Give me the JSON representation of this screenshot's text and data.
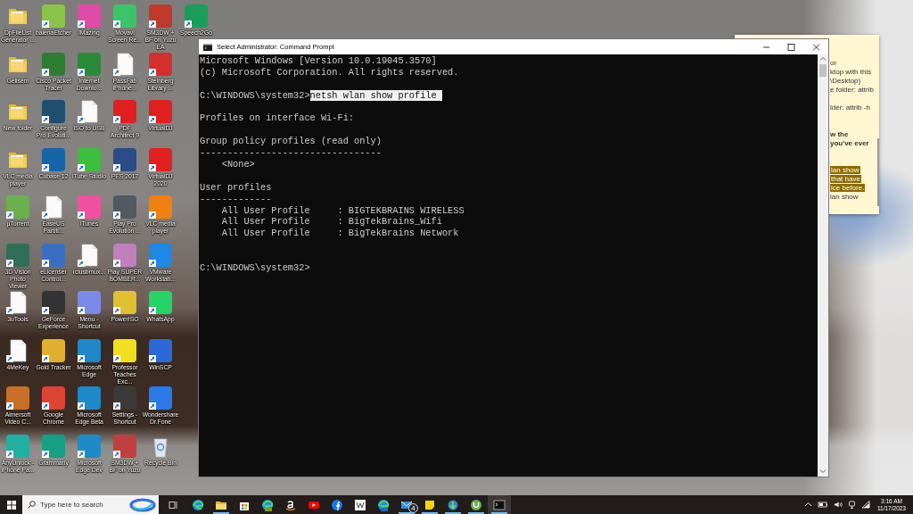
{
  "desktop_icon_rows": [
    [
      {
        "label": "DpFileList Generator ...",
        "kind": "folder",
        "shortcut": false
      },
      {
        "label": "balenaEtcher",
        "kind": "app",
        "color": "#8bc34a",
        "shortcut": true
      },
      {
        "label": "iMazing",
        "kind": "app",
        "color": "#e04aa8",
        "shortcut": true
      },
      {
        "label": "Movavi Screen Re...",
        "kind": "app",
        "color": "#3cc46a",
        "shortcut": true
      },
      {
        "label": "SM3DW + BF on Yuzu EA",
        "kind": "app",
        "color": "#c0392b",
        "shortcut": true
      },
      {
        "label": "Speech2Go",
        "kind": "app",
        "color": "#1a9e5a",
        "shortcut": true
      }
    ],
    [
      {
        "label": "Gelisem",
        "kind": "folder",
        "shortcut": false
      },
      {
        "label": "Cisco Packet Tracer",
        "kind": "app",
        "color": "#2e7d32",
        "shortcut": true
      },
      {
        "label": "Internet Downlo...",
        "kind": "app",
        "color": "#2a8a3a",
        "shortcut": true
      },
      {
        "label": "PassFab iPhone...",
        "kind": "document",
        "shortcut": true
      },
      {
        "label": "Steinberg Library ...",
        "kind": "app",
        "color": "#d32f2f",
        "shortcut": true
      }
    ],
    [
      {
        "label": "New folder",
        "kind": "folder",
        "shortcut": false
      },
      {
        "label": "Configure Pro Evoluti...",
        "kind": "app",
        "color": "#1f4e6e",
        "shortcut": true
      },
      {
        "label": "ISO to USB",
        "kind": "document",
        "shortcut": true
      },
      {
        "label": "PDF Architect 9",
        "kind": "app",
        "color": "#e02020",
        "shortcut": true
      },
      {
        "label": "VirtualDJ",
        "kind": "app",
        "color": "#e0201f",
        "shortcut": true
      }
    ],
    [
      {
        "label": "VLC media player",
        "kind": "folder",
        "shortcut": false
      },
      {
        "label": "Cubase 12",
        "kind": "app",
        "color": "#1565a8",
        "shortcut": true
      },
      {
        "label": "iTube Studio",
        "kind": "app",
        "color": "#3cbf3c",
        "shortcut": true
      },
      {
        "label": "PES 2017",
        "kind": "app",
        "color": "#2a4d8a",
        "shortcut": true
      },
      {
        "label": "VirtualDJ 2020",
        "kind": "app",
        "color": "#e0211f",
        "shortcut": true
      }
    ],
    [
      {
        "label": "µTorrent",
        "kind": "app",
        "color": "#6ab04c",
        "shortcut": true
      },
      {
        "label": "EaseUS Partiti...",
        "kind": "document",
        "shortcut": true
      },
      {
        "label": "iTunes",
        "kind": "app",
        "color": "#f050a0",
        "shortcut": true
      },
      {
        "label": "Play Pro Evolution ...",
        "kind": "app",
        "color": "#505a60",
        "shortcut": true
      },
      {
        "label": "VLC media player",
        "kind": "app",
        "color": "#f08010",
        "shortcut": true
      }
    ],
    [
      {
        "label": "3D Vision Photo Viewer",
        "kind": "app",
        "color": "#2f6f5a",
        "shortcut": true
      },
      {
        "label": "eLicenser Control...",
        "kind": "app",
        "color": "#3a6ec0",
        "shortcut": true
      },
      {
        "label": "Iclusbmux...",
        "kind": "document",
        "shortcut": true
      },
      {
        "label": "Play SUPER BOMBER...",
        "kind": "app",
        "color": "#c080c0",
        "shortcut": true
      },
      {
        "label": "VMware Workstati...",
        "kind": "app",
        "color": "#1e88e5",
        "shortcut": true
      }
    ],
    [
      {
        "label": "3uTools",
        "kind": "document",
        "shortcut": true
      },
      {
        "label": "GeForce Experience",
        "kind": "app",
        "color": "#333333",
        "shortcut": true
      },
      {
        "label": "Menu - Shortcut",
        "kind": "app",
        "color": "#7a8ae8",
        "shortcut": true
      },
      {
        "label": "PowerISO",
        "kind": "app",
        "color": "#e0c030",
        "shortcut": true
      },
      {
        "label": "WhatsApp",
        "kind": "app",
        "color": "#25d366",
        "shortcut": true
      }
    ],
    [
      {
        "label": "4MeKey",
        "kind": "document",
        "shortcut": true
      },
      {
        "label": "Gold Tracker",
        "kind": "app",
        "color": "#e0b030",
        "shortcut": true
      },
      {
        "label": "Microsoft Edge",
        "kind": "app",
        "color": "#1e88c8",
        "shortcut": true
      },
      {
        "label": "Professor Teaches Exc...",
        "kind": "app",
        "color": "#f0e020",
        "shortcut": true
      },
      {
        "label": "WinSCP",
        "kind": "app",
        "color": "#2a6ad8",
        "shortcut": true
      }
    ],
    [
      {
        "label": "Aimersoft Video C...",
        "kind": "app",
        "color": "#c87028",
        "shortcut": true
      },
      {
        "label": "Google Chrome",
        "kind": "app",
        "color": "#dd4433",
        "shortcut": true
      },
      {
        "label": "Microsoft Edge Beta",
        "kind": "app",
        "color": "#1e89c8",
        "shortcut": true
      },
      {
        "label": "Settings - Shortcut",
        "kind": "app",
        "color": "#3a3a3a",
        "shortcut": true
      },
      {
        "label": "Wondershare Dr.Fone",
        "kind": "app",
        "color": "#2a7ae8",
        "shortcut": true
      }
    ],
    [
      {
        "label": "AnyUnlock - iPhone Pa...",
        "kind": "app",
        "color": "#20b0a0",
        "shortcut": true
      },
      {
        "label": "Grammarly",
        "kind": "app",
        "color": "#15a085",
        "shortcut": true
      },
      {
        "label": "Microsoft Edge Dev",
        "kind": "app",
        "color": "#1e8ac8",
        "shortcut": true
      },
      {
        "label": "SM3DW + BF on Yuzu",
        "kind": "app",
        "color": "#c04040",
        "shortcut": true
      },
      {
        "label": "Recycle Bin",
        "kind": "recycle",
        "shortcut": false
      }
    ]
  ],
  "sticky_note": {
    "lines": [
      {
        "kind": "plain",
        "text": "or"
      },
      {
        "kind": "plain",
        "text": "ktop with this"
      },
      {
        "kind": "plain",
        "text": "\\Desktop)"
      },
      {
        "kind": "plain",
        "text": "e folder: attrib"
      },
      {
        "kind": "blank"
      },
      {
        "kind": "plain",
        "text": "lder: attrib -h"
      },
      {
        "kind": "blank"
      },
      {
        "kind": "blank"
      },
      {
        "kind": "bold",
        "text": "w the"
      },
      {
        "kind": "bold",
        "text": "you've ever"
      },
      {
        "kind": "blank"
      },
      {
        "kind": "blank"
      },
      {
        "kind": "highlight",
        "text": "lan show"
      },
      {
        "kind": "highlight",
        "text": "that have"
      },
      {
        "kind": "highlight",
        "text": "ice before."
      },
      {
        "kind": "plain",
        "text": "lan show"
      }
    ]
  },
  "console_window": {
    "title": "Select Administrator: Command Prompt",
    "lines": [
      {
        "kind": "output",
        "text": "Microsoft Windows [Version 10.0.19045.3570]"
      },
      {
        "kind": "output",
        "text": "(c) Microsoft Corporation. All rights reserved."
      },
      {
        "kind": "blank"
      },
      {
        "kind": "prompt",
        "prompt": "C:\\WINDOWS\\system32>",
        "command": "netsh wlan show profile",
        "selected": true
      },
      {
        "kind": "blank"
      },
      {
        "kind": "output",
        "text": "Profiles on interface Wi-Fi:"
      },
      {
        "kind": "blank"
      },
      {
        "kind": "output",
        "text": "Group policy profiles (read only)"
      },
      {
        "kind": "output",
        "text": "---------------------------------"
      },
      {
        "kind": "output",
        "text": "    <None>"
      },
      {
        "kind": "blank"
      },
      {
        "kind": "output",
        "text": "User profiles"
      },
      {
        "kind": "output",
        "text": "-------------"
      },
      {
        "kind": "output",
        "text": "    All User Profile     : BIGTEKBRAINS WIRELESS"
      },
      {
        "kind": "output",
        "text": "    All User Profile     : BigTekBrains_Wifi"
      },
      {
        "kind": "output",
        "text": "    All User Profile     : BigTekBrains Network"
      },
      {
        "kind": "blank"
      },
      {
        "kind": "blank"
      },
      {
        "kind": "prompt",
        "prompt": "C:\\WINDOWS\\system32>"
      }
    ]
  },
  "taskbar": {
    "search": {
      "placeholder": "Type here to search"
    },
    "apps": [
      {
        "kind": "edge",
        "running": false,
        "selected": false
      },
      {
        "kind": "explorer",
        "running": true,
        "selected": false
      },
      {
        "kind": "store",
        "running": false,
        "selected": false
      },
      {
        "kind": "edge-dev",
        "running": false,
        "selected": false
      },
      {
        "kind": "amazon",
        "running": false,
        "selected": false
      },
      {
        "kind": "youtube",
        "running": false,
        "selected": false
      },
      {
        "kind": "facebook",
        "running": false,
        "selected": false
      },
      {
        "kind": "wiki",
        "running": false,
        "selected": false
      },
      {
        "kind": "edge-beta",
        "running": false,
        "selected": false
      },
      {
        "kind": "mail",
        "running": true,
        "selected": false,
        "badge": "4"
      },
      {
        "kind": "sticky",
        "running": true,
        "selected": false
      },
      {
        "kind": "download",
        "running": true,
        "selected": false
      },
      {
        "kind": "torrent",
        "running": true,
        "selected": false
      },
      {
        "kind": "console",
        "running": true,
        "selected": true
      }
    ],
    "clock": {
      "time": "3:16 AM",
      "date": "11/17/2023"
    }
  }
}
